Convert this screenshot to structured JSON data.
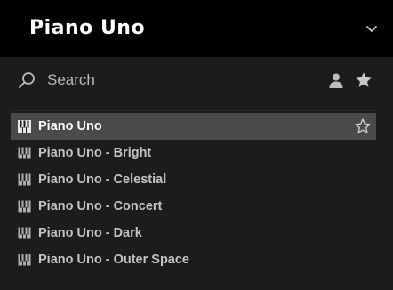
{
  "header": {
    "title": "Piano Uno",
    "chevron_icon": "chevron-down-icon"
  },
  "search": {
    "label": "Search",
    "search_icon": "search-icon",
    "user_icon": "user-icon",
    "star_icon": "star-icon"
  },
  "presets": [
    {
      "label": "Piano Uno",
      "selected": true,
      "favorite": false
    },
    {
      "label": "Piano Uno - Bright",
      "selected": false
    },
    {
      "label": "Piano Uno - Celestial",
      "selected": false
    },
    {
      "label": "Piano Uno - Concert",
      "selected": false
    },
    {
      "label": "Piano Uno - Dark",
      "selected": false
    },
    {
      "label": "Piano Uno - Outer Space",
      "selected": false
    }
  ],
  "colors": {
    "background": "#1c1c1c",
    "header": "#000000",
    "selected_row": "#4a4a4a",
    "text": "#c4c4c4",
    "text_selected": "#ffffff"
  }
}
